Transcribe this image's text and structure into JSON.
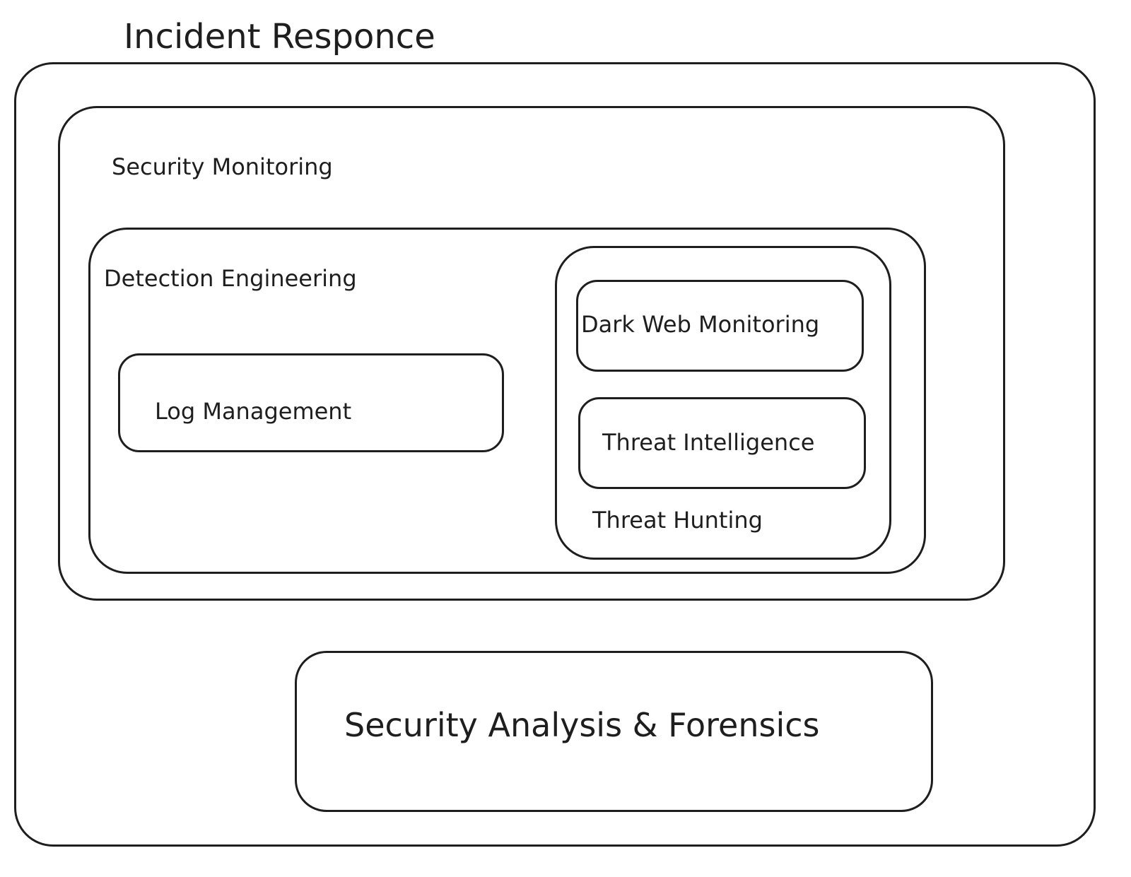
{
  "diagram": {
    "title": "Incident Responce",
    "boxes": {
      "security_monitoring": "Security Monitoring",
      "detection_engineering": "Detection Engineering",
      "log_management": "Log Management",
      "dark_web_monitoring": "Dark Web Monitoring",
      "threat_intelligence": "Threat Intelligence",
      "threat_hunting": "Threat Hunting",
      "security_analysis_forensics": "Security Analysis & Forensics"
    },
    "colors": {
      "stroke": "#1e1e1e",
      "background": "#ffffff"
    }
  }
}
